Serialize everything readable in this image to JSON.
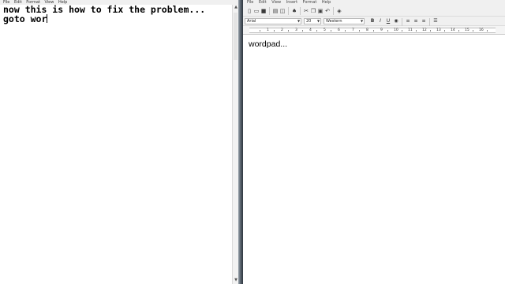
{
  "notepad": {
    "menu": [
      "File",
      "Edit",
      "Format",
      "View",
      "Help"
    ],
    "lines": [
      "now this is how to fix the problem...",
      "goto wor"
    ]
  },
  "wordpad": {
    "menu": [
      "File",
      "Edit",
      "View",
      "Insert",
      "Format",
      "Help"
    ],
    "font_name": "Arial",
    "font_size": "20",
    "script": "Western",
    "body_text": "wordpad...",
    "ruler_numbers": [
      "1",
      "2",
      "3",
      "4",
      "5",
      "6",
      "7",
      "8",
      "9",
      "10",
      "11",
      "12",
      "13",
      "14",
      "15",
      "16"
    ]
  }
}
